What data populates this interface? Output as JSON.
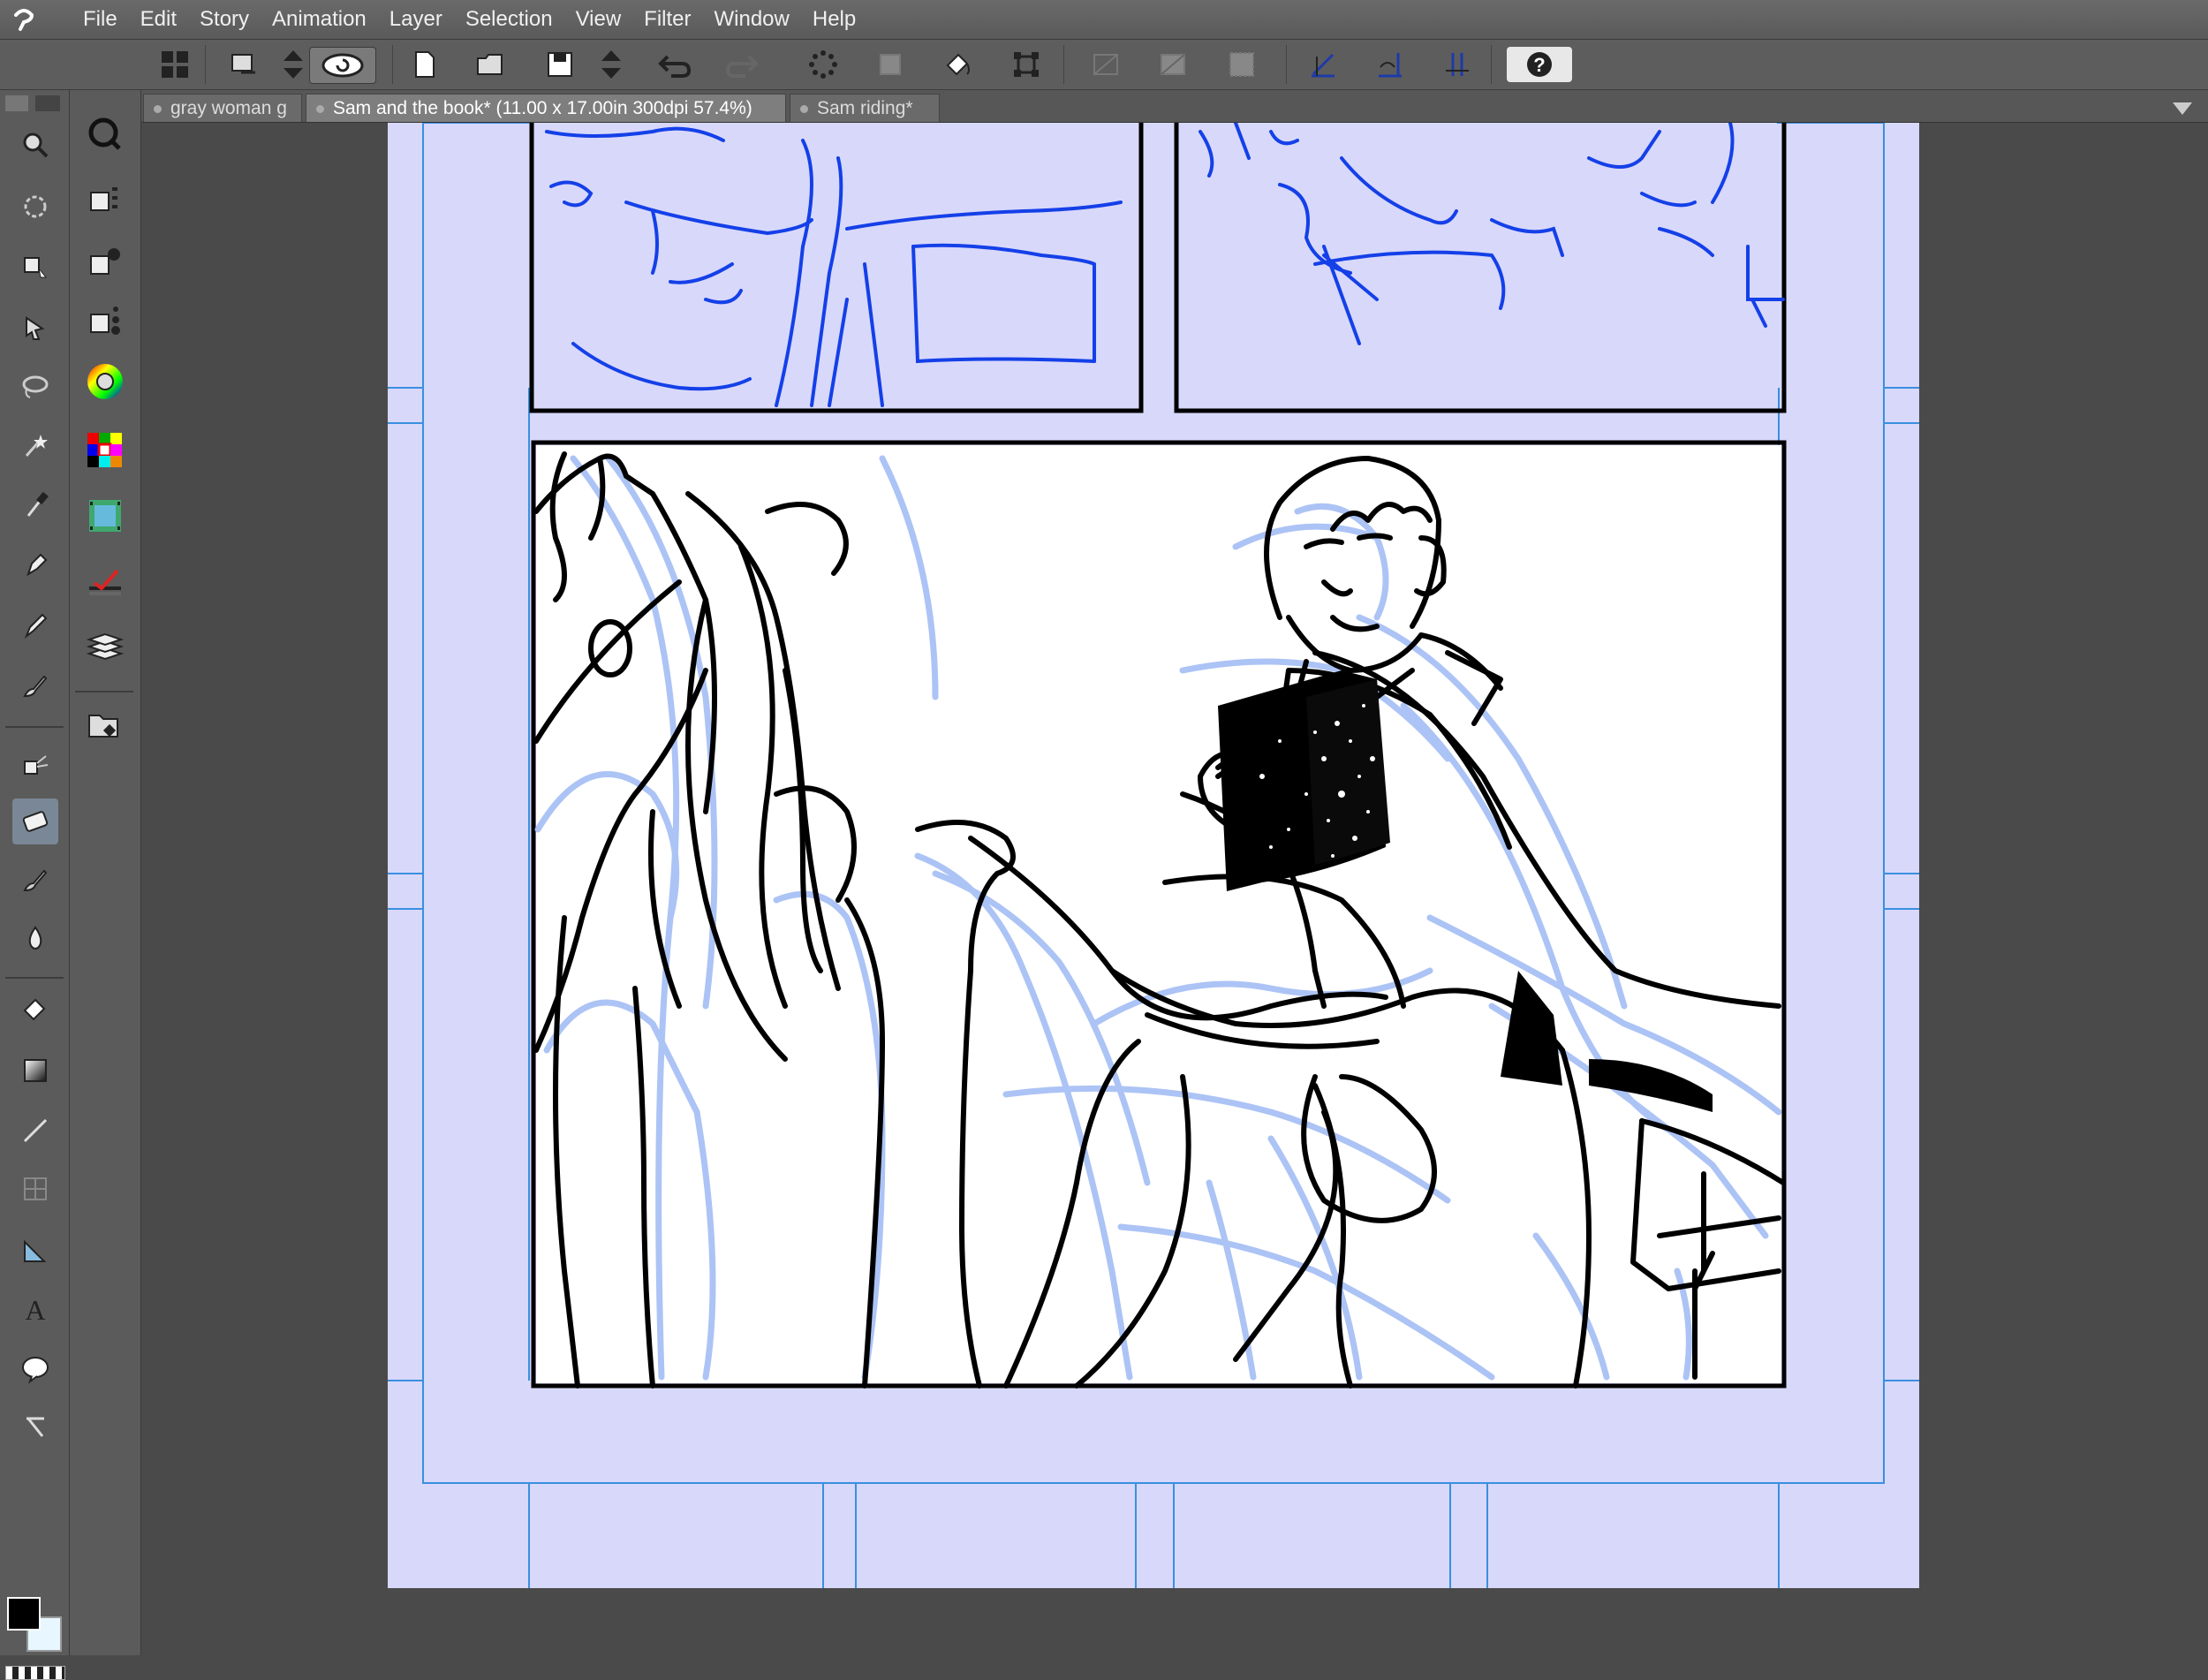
{
  "menu": [
    "File",
    "Edit",
    "Story",
    "Animation",
    "Layer",
    "Selection",
    "View",
    "Filter",
    "Window",
    "Help"
  ],
  "tabs": [
    {
      "label": "gray woman g"
    },
    {
      "label": "Sam and the book* (11.00 x 17.00in 300dpi 57.4%)"
    },
    {
      "label": "Sam riding*"
    }
  ],
  "colors": {
    "main": "#000000",
    "sub": "#e8f6ff",
    "page": "#d8d8fa",
    "sketch": "#1440e8",
    "pencil": "#a8c0f5"
  },
  "icons": {
    "command_bar": [
      "workspace-grid-icon",
      "transform-icon",
      "up-down-icon",
      "rotate-icon",
      "new-page-icon",
      "open-icon",
      "save-icon",
      "up-down-icon",
      "undo-icon",
      "redo-icon",
      "deselect-icon",
      "selection-icon",
      "fill-icon",
      "transform-selection-icon",
      "ruler-off-icon",
      "ruler-icon",
      "grid-icon",
      "perspective-ruler-icon",
      "symmetry-ruler-icon",
      "snap-icon",
      "help-icon"
    ],
    "tools": [
      "zoom-icon",
      "rotate-view-icon",
      "object-icon",
      "operation-icon",
      "lasso-icon",
      "magic-wand-icon",
      "eyedropper-icon",
      "pen-icon",
      "pencil-icon",
      "brush-icon",
      "airbrush-icon",
      "eraser-icon",
      "blend-icon",
      "liquify-icon",
      "fill-icon",
      "gradient-icon",
      "line-icon",
      "frame-icon",
      "ruler-icon",
      "text-icon",
      "balloon-icon",
      "correction-icon"
    ]
  }
}
